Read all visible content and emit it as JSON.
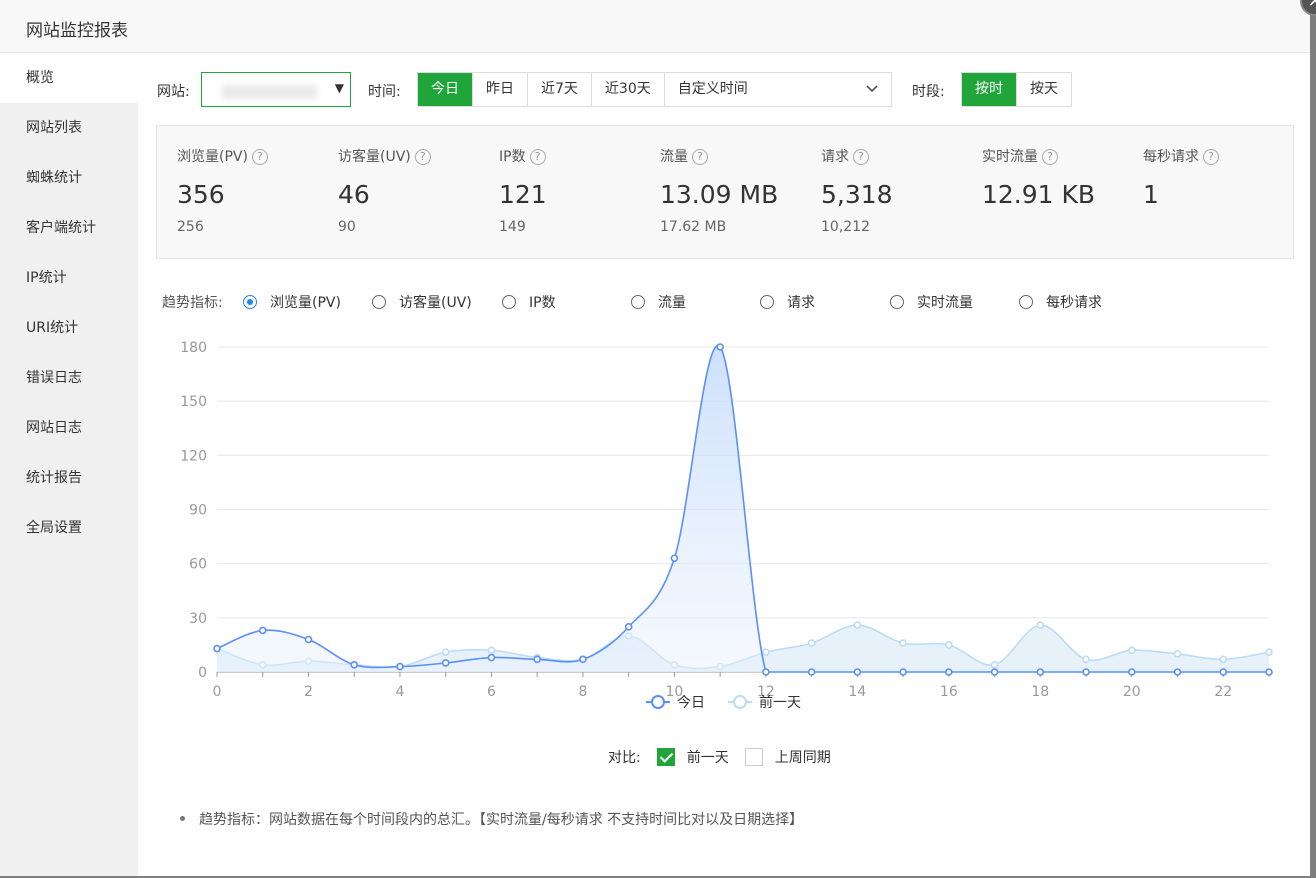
{
  "window": {
    "title": "网站监控报表",
    "close_glyph": "×"
  },
  "sidebar": {
    "items": [
      {
        "label": "概览",
        "active": true
      },
      {
        "label": "网站列表"
      },
      {
        "label": "蜘蛛统计"
      },
      {
        "label": "客户端统计"
      },
      {
        "label": "IP统计"
      },
      {
        "label": "URI统计"
      },
      {
        "label": "错误日志"
      },
      {
        "label": "网站日志"
      },
      {
        "label": "统计报告"
      },
      {
        "label": "全局设置"
      }
    ]
  },
  "toolbar": {
    "site_label": "网站:",
    "time_label": "时间:",
    "time_options": [
      "今日",
      "昨日",
      "近7天",
      "近30天"
    ],
    "time_selected": "今日",
    "custom_time_placeholder": "自定义时间",
    "period_label": "时段:",
    "period_options": [
      "按时",
      "按天"
    ],
    "period_selected": "按时"
  },
  "stats": [
    {
      "name": "浏览量(PV)",
      "value": "356",
      "prev": "256"
    },
    {
      "name": "访客量(UV)",
      "value": "46",
      "prev": "90"
    },
    {
      "name": "IP数",
      "value": "121",
      "prev": "149"
    },
    {
      "name": "流量",
      "value": "13.09 MB",
      "prev": "17.62 MB"
    },
    {
      "name": "请求",
      "value": "5,318",
      "prev": "10,212"
    },
    {
      "name": "实时流量",
      "value": "12.91 KB",
      "prev": ""
    },
    {
      "name": "每秒请求",
      "value": "1",
      "prev": ""
    }
  ],
  "trend": {
    "label": "趋势指标:",
    "options": [
      "浏览量(PV)",
      "访客量(UV)",
      "IP数",
      "流量",
      "请求",
      "实时流量",
      "每秒请求"
    ],
    "selected": "浏览量(PV)"
  },
  "compare": {
    "label": "对比:",
    "options": [
      {
        "label": "前一天",
        "checked": true
      },
      {
        "label": "上周同期",
        "checked": false
      }
    ]
  },
  "note": "趋势指标：网站数据在每个时间段内的总汇。【实时流量/每秒请求 不支持时间比对以及日期选择】",
  "colors": {
    "accent": "#20a53a",
    "today": "#5b8ff9",
    "yesterday": "#bcdcf5"
  },
  "chart_data": {
    "type": "area",
    "x": [
      0,
      1,
      2,
      3,
      4,
      5,
      6,
      7,
      8,
      9,
      10,
      11,
      12,
      13,
      14,
      15,
      16,
      17,
      18,
      19,
      20,
      21,
      22,
      23
    ],
    "xticks": [
      0,
      2,
      4,
      6,
      8,
      10,
      12,
      14,
      16,
      18,
      20,
      22
    ],
    "ylim": [
      0,
      180
    ],
    "yticks": [
      0,
      30,
      60,
      90,
      120,
      150,
      180
    ],
    "grid": true,
    "legend": "bottom",
    "series": [
      {
        "name": "今日",
        "values": [
          13,
          23,
          18,
          4,
          3,
          5,
          8,
          7,
          7,
          25,
          63,
          180,
          0,
          0,
          0,
          0,
          0,
          0,
          0,
          0,
          0,
          0,
          0,
          0
        ]
      },
      {
        "name": "前一天",
        "values": [
          13,
          4,
          6,
          4,
          3,
          11,
          12,
          8,
          7,
          20,
          4,
          3,
          11,
          16,
          26,
          16,
          15,
          4,
          26,
          7,
          12,
          10,
          7,
          11
        ]
      }
    ]
  }
}
